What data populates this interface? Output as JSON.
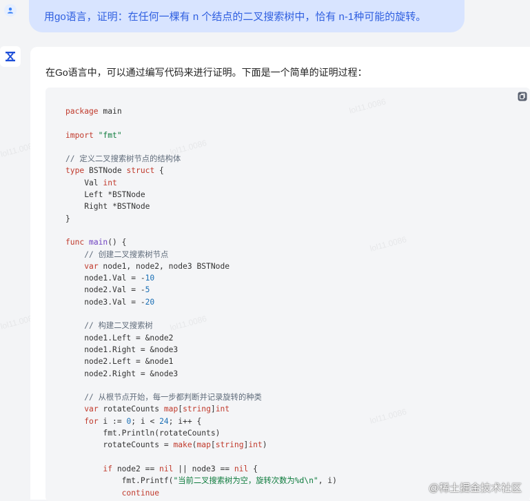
{
  "user_message": "用go语言，证明：在任何一棵有 n 个结点的二叉搜索树中，恰有 n-1种可能的旋转。",
  "bot_intro": "在Go语言中，可以通过编写代码来进行证明。下面是一个简单的证明过程：",
  "code_lines": [
    "package main",
    "",
    "import \"fmt\"",
    "",
    "// 定义二叉搜索树节点的结构体",
    "type BSTNode struct {",
    "    Val int",
    "    Left *BSTNode",
    "    Right *BSTNode",
    "}",
    "",
    "func main() {",
    "    // 创建二叉搜索树节点",
    "    var node1, node2, node3 BSTNode",
    "    node1.Val = -10",
    "    node2.Val = -5",
    "    node3.Val = -20",
    "",
    "    // 构建二叉搜索树",
    "    node1.Left = &node2",
    "    node1.Right = &node3",
    "    node2.Left = &node1",
    "    node2.Right = &node3",
    "",
    "    // 从根节点开始，每一步都判断并记录旋转的种类",
    "    var rotateCounts map[string]int",
    "    for i := 0; i < 24; i++ {",
    "        fmt.Println(rotateCounts)",
    "        rotateCounts = make(map[string]int)",
    "",
    "        if node2 == nil || node3 == nil {",
    "            fmt.Printf(\"当前二叉搜索树为空，旋转次数为%d\\n\", i)",
    "            continue"
  ],
  "watermark": "@稀土掘金技术社区",
  "faint_watermark": "lol11.0086"
}
